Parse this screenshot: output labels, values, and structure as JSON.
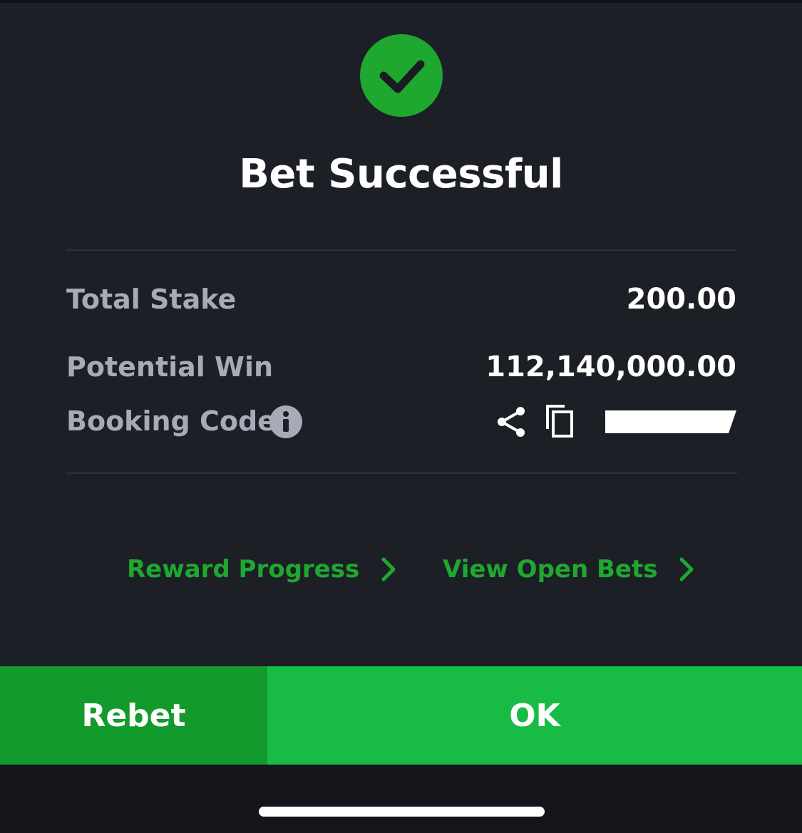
{
  "dialog": {
    "title": "Bet Successful",
    "icon": "checkmark-circle-icon"
  },
  "summary": {
    "total_stake_label": "Total Stake",
    "total_stake_value": "200.00",
    "potential_win_label": "Potential Win",
    "potential_win_value": "112,140,000.00",
    "booking_code_label": "Booking Code"
  },
  "links": {
    "reward_progress": "Reward Progress",
    "view_open_bets": "View Open Bets"
  },
  "buttons": {
    "rebet": "Rebet",
    "ok": "OK"
  },
  "colors": {
    "background": "#1d1f27",
    "accent_green": "#1fa82f",
    "rebet_green": "#139a2c",
    "ok_green": "#19bb47",
    "label_gray": "#a7abb7"
  }
}
